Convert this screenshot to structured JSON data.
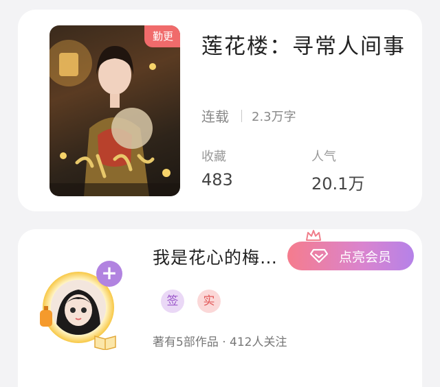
{
  "book": {
    "badge": "勤更",
    "title": "莲花楼：寻常人间事",
    "status": "连载",
    "word_count": "2.3万字",
    "stats": [
      {
        "label": "收藏",
        "value": "483"
      },
      {
        "label": "人气",
        "value": "20.1万"
      }
    ]
  },
  "author": {
    "name": "我是花心的梅…",
    "follow_icon": "plus-icon",
    "vip_button": "点亮会员",
    "tags": [
      "签",
      "实"
    ],
    "info": "著有5部作品 · 412人关注"
  },
  "colors": {
    "background": "#f3f3f5",
    "badge": "#f06b6b",
    "follow": "#b183e0",
    "vip_gradient_start": "#f57c8d",
    "vip_gradient_end": "#b582e8"
  }
}
